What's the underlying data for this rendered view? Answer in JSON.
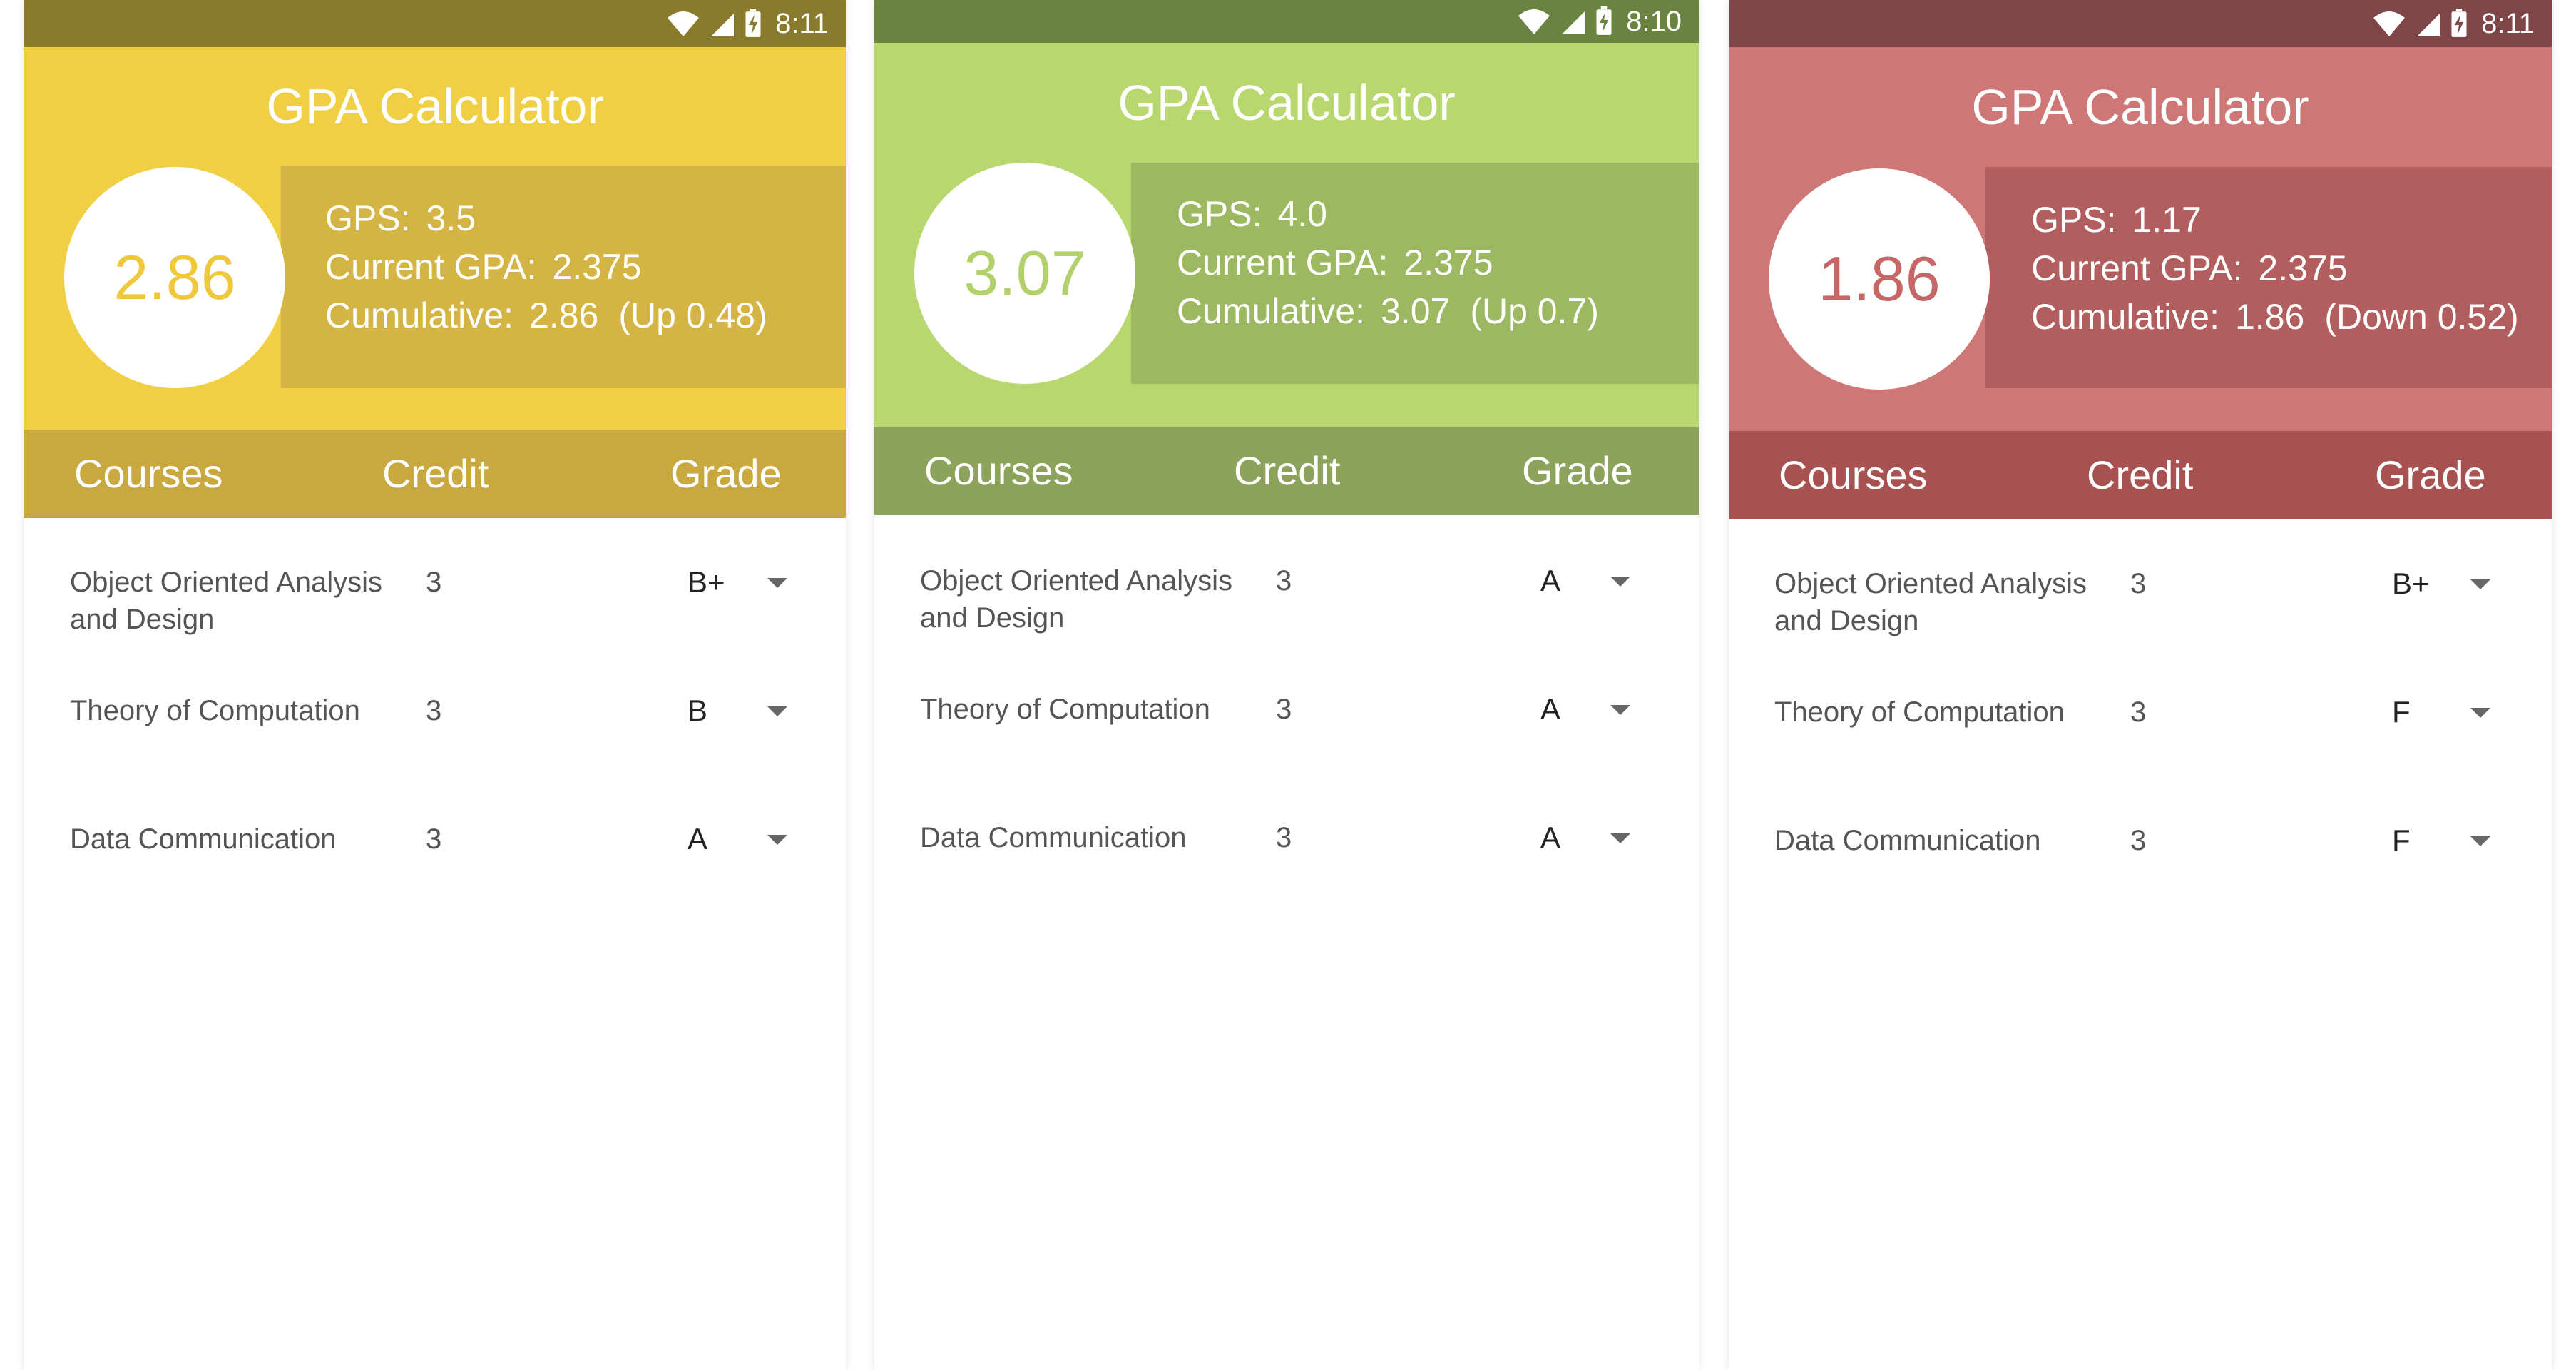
{
  "screens": [
    {
      "status_time": "8:11",
      "title": "GPA Calculator",
      "gpa_circle": "2.86",
      "stats": {
        "gps_label": "GPS:",
        "gps_value": "3.5",
        "current_label": "Current GPA:",
        "current_value": "2.375",
        "cumulative_label": "Cumulative:",
        "cumulative_value": "2.86",
        "change": "(Up 0.48)"
      },
      "headers": {
        "courses": "Courses",
        "credit": "Credit",
        "grade": "Grade"
      },
      "courses": [
        {
          "name": "Object Oriented Analysis and Design",
          "credit": "3",
          "grade": "B+"
        },
        {
          "name": "Theory of Computation",
          "credit": "3",
          "grade": "B"
        },
        {
          "name": "Data Communication",
          "credit": "3",
          "grade": "A"
        }
      ],
      "colors": {
        "status": "#8a7a2c",
        "appbar": "#f0cf44",
        "panel": "#d4b444",
        "header": "#c9a83f",
        "circle_text": "#efc83b"
      }
    },
    {
      "status_time": "8:10",
      "title": "GPA Calculator",
      "gpa_circle": "3.07",
      "stats": {
        "gps_label": "GPS:",
        "gps_value": "4.0",
        "current_label": "Current GPA:",
        "current_value": "2.375",
        "cumulative_label": "Cumulative:",
        "cumulative_value": "3.07",
        "change": "(Up 0.7)"
      },
      "headers": {
        "courses": "Courses",
        "credit": "Credit",
        "grade": "Grade"
      },
      "courses": [
        {
          "name": "Object Oriented Analysis and Design",
          "credit": "3",
          "grade": "A"
        },
        {
          "name": "Theory of Computation",
          "credit": "3",
          "grade": "A"
        },
        {
          "name": "Data Communication",
          "credit": "3",
          "grade": "A"
        }
      ],
      "colors": {
        "status": "#6a8340",
        "appbar": "#b8d76e",
        "panel": "#9cb860",
        "header": "#8da35c",
        "circle_text": "#b3d16a"
      }
    },
    {
      "status_time": "8:11",
      "title": "GPA Calculator",
      "gpa_circle": "1.86",
      "stats": {
        "gps_label": "GPS:",
        "gps_value": "1.17",
        "current_label": "Current GPA:",
        "current_value": "2.375",
        "cumulative_label": "Cumulative:",
        "cumulative_value": "1.86",
        "change": "(Down 0.52)"
      },
      "headers": {
        "courses": "Courses",
        "credit": "Credit",
        "grade": "Grade"
      },
      "courses": [
        {
          "name": "Object Oriented Analysis and Design",
          "credit": "3",
          "grade": "B+"
        },
        {
          "name": "Theory of Computation",
          "credit": "3",
          "grade": "F"
        },
        {
          "name": "Data Communication",
          "credit": "3",
          "grade": "F"
        }
      ],
      "colors": {
        "status": "#7f4547",
        "appbar": "#cf7676",
        "panel": "#b35e5e",
        "header": "#a75250",
        "circle_text": "#c66666"
      }
    }
  ],
  "icons": [
    "wifi-icon",
    "cell-signal-icon",
    "battery-charging-icon",
    "dropdown-arrow-icon"
  ]
}
